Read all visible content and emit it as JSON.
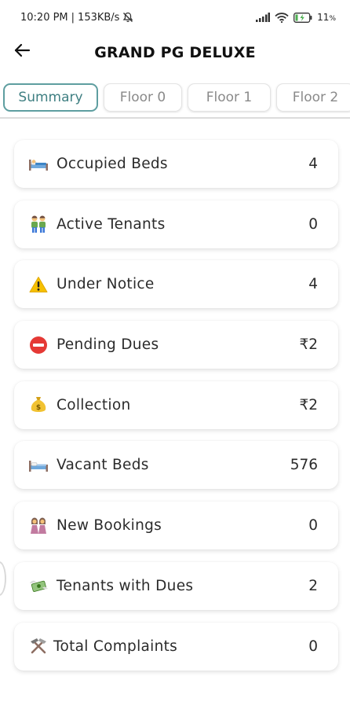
{
  "status": {
    "time": "10:20 PM",
    "separator": "|",
    "speed": "153KB/s",
    "battery": "11"
  },
  "header": {
    "title": "GRAND PG DELUXE"
  },
  "tabs": [
    {
      "label": "Summary",
      "active": true
    },
    {
      "label": "Floor 0",
      "active": false
    },
    {
      "label": "Floor 1",
      "active": false
    },
    {
      "label": "Floor 2",
      "active": false
    }
  ],
  "cards": [
    {
      "icon": "bed-icon",
      "label": "Occupied Beds",
      "value": "4"
    },
    {
      "icon": "people-icon",
      "label": "Active Tenants",
      "value": "0"
    },
    {
      "icon": "warning-icon",
      "label": "Under Notice",
      "value": "4"
    },
    {
      "icon": "no-entry-icon",
      "label": "Pending Dues",
      "value": "₹2"
    },
    {
      "icon": "money-bag-icon",
      "label": "Collection",
      "value": "₹2"
    },
    {
      "icon": "bed-icon",
      "label": "Vacant Beds",
      "value": "576"
    },
    {
      "icon": "women-icon",
      "label": "New Bookings",
      "value": "0"
    },
    {
      "icon": "money-wings-icon",
      "label": "Tenants with Dues",
      "value": "2"
    },
    {
      "icon": "tools-icon",
      "label": "Total Complaints",
      "value": "0"
    }
  ],
  "colors": {
    "accent": "#5e9ea0",
    "tab_inactive_text": "#8a8a8a",
    "card_bg": "#ffffff"
  }
}
